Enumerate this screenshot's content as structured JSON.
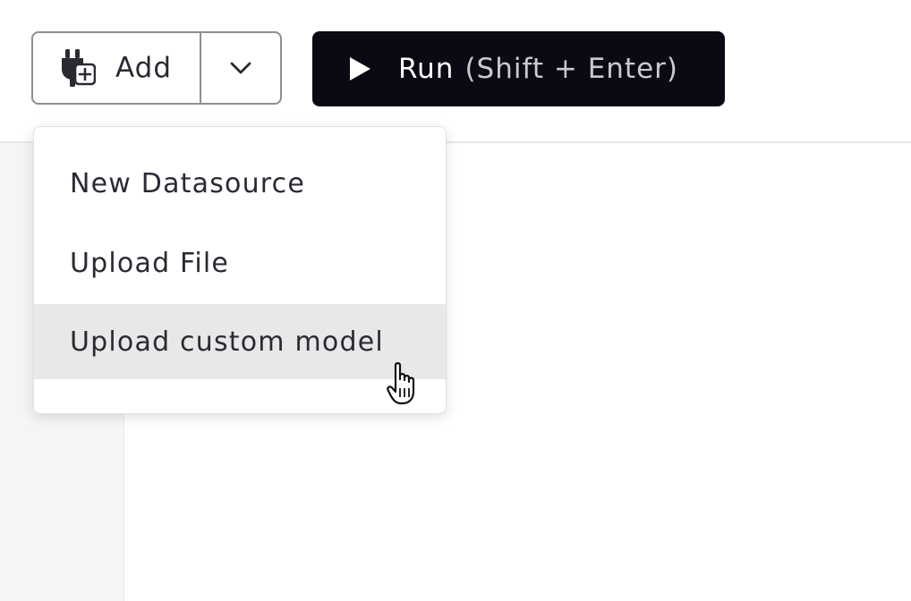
{
  "toolbar": {
    "add_label": "Add",
    "add_icon": "plug-add-icon",
    "caret_icon": "chevron-down-icon",
    "run_label": "Run",
    "run_hint": "(Shift + Enter)",
    "run_icon": "play-icon",
    "run_bg_color": "#0a0a14"
  },
  "dropdown": {
    "items": [
      {
        "label": "New Datasource",
        "hovered": false
      },
      {
        "label": "Upload File",
        "hovered": false
      },
      {
        "label": "Upload custom model",
        "hovered": true
      }
    ],
    "hover_color": "#e8e8e9"
  },
  "cursor": {
    "icon": "hand-pointer-icon"
  }
}
